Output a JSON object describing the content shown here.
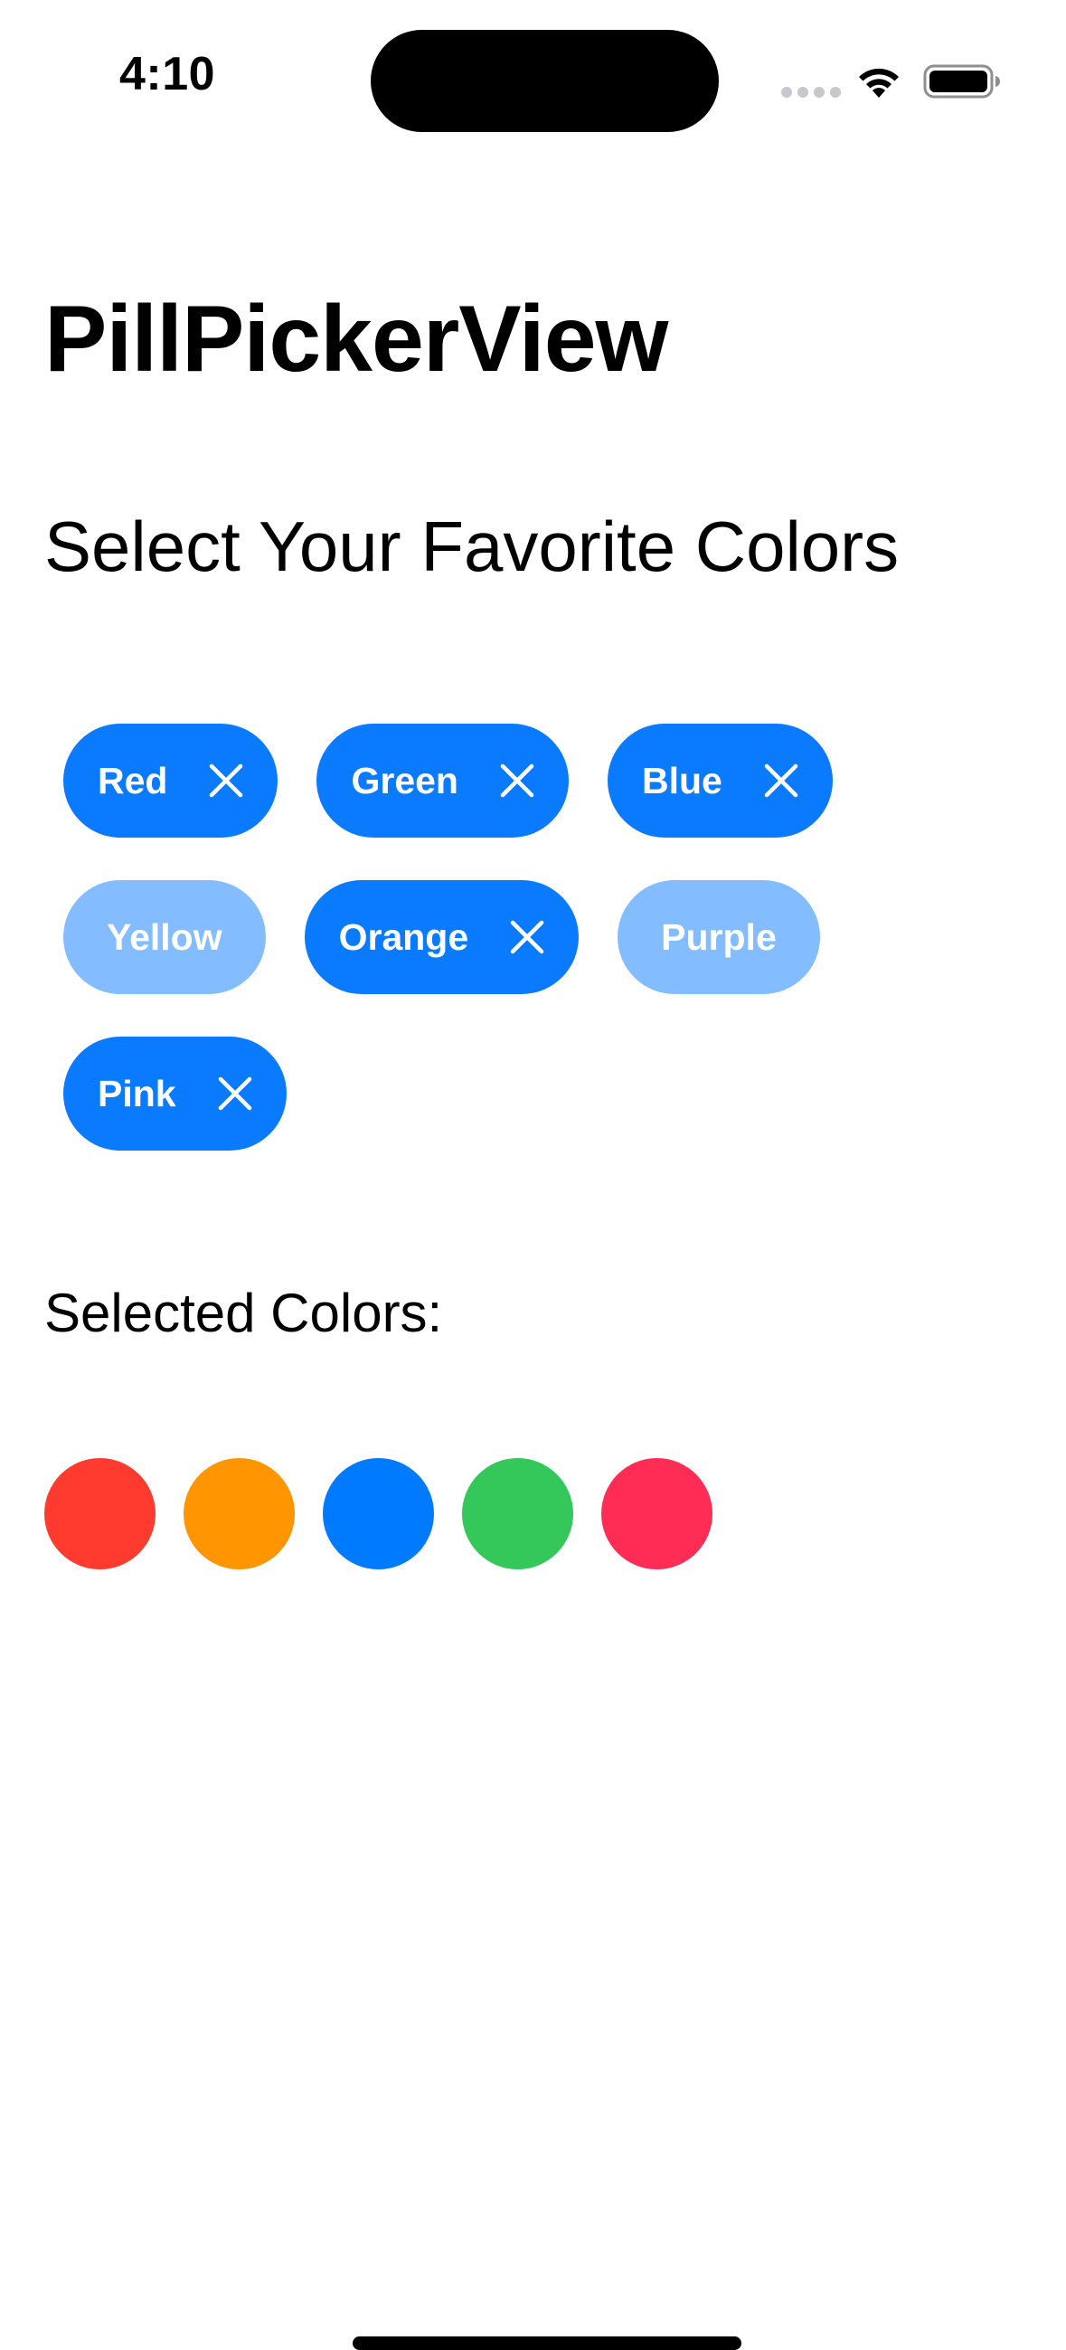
{
  "status_bar": {
    "time": "4:10"
  },
  "title": "PillPickerView",
  "section_title": "Select Your Favorite Colors",
  "pills": [
    [
      {
        "label": "Red",
        "selected": true
      },
      {
        "label": "Green",
        "selected": true
      },
      {
        "label": "Blue",
        "selected": true
      }
    ],
    [
      {
        "label": "Yellow",
        "selected": false
      },
      {
        "label": "Orange",
        "selected": true
      },
      {
        "label": "Purple",
        "selected": false
      }
    ],
    [
      {
        "label": "Pink",
        "selected": true
      }
    ]
  ],
  "selected_title": "Selected Colors:",
  "selected_swatches": [
    {
      "name": "red",
      "color": "#ff3b30"
    },
    {
      "name": "orange",
      "color": "#ff9500"
    },
    {
      "name": "blue",
      "color": "#007aff"
    },
    {
      "name": "green",
      "color": "#34c759"
    },
    {
      "name": "pink",
      "color": "#ff2d55"
    }
  ],
  "colors": {
    "accent": "#0a7aff",
    "accent_unselected": "#84bdff"
  }
}
